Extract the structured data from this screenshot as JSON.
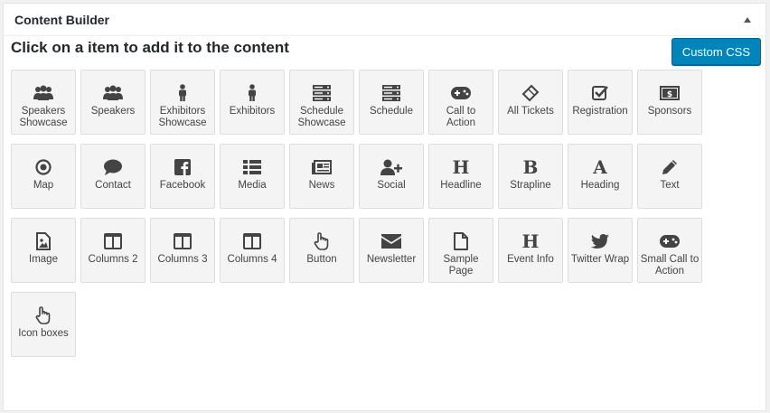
{
  "panel": {
    "title": "Content Builder",
    "subheading": "Click on a item to add it to the content",
    "custom_css_label": "Custom CSS"
  },
  "items": [
    {
      "label": "Speakers Showcase",
      "icon": "group-icon"
    },
    {
      "label": "Speakers",
      "icon": "group-icon"
    },
    {
      "label": "Exhibitors Showcase",
      "icon": "person-icon"
    },
    {
      "label": "Exhibitors",
      "icon": "person-icon"
    },
    {
      "label": "Schedule Showcase",
      "icon": "server-icon"
    },
    {
      "label": "Schedule",
      "icon": "server-icon"
    },
    {
      "label": "Call to Action",
      "icon": "gamepad-icon"
    },
    {
      "label": "All Tickets",
      "icon": "ticket-icon"
    },
    {
      "label": "Registration",
      "icon": "checkbox-icon"
    },
    {
      "label": "Sponsors",
      "icon": "money-icon"
    },
    {
      "label": "Map",
      "icon": "dot-circle-icon"
    },
    {
      "label": "Contact",
      "icon": "comment-icon"
    },
    {
      "label": "Facebook",
      "icon": "facebook-icon"
    },
    {
      "label": "Media",
      "icon": "list-icon"
    },
    {
      "label": "News",
      "icon": "newspaper-icon"
    },
    {
      "label": "Social",
      "icon": "user-plus-icon"
    },
    {
      "label": "Headline",
      "icon": "header-icon"
    },
    {
      "label": "Strapline",
      "icon": "bold-icon"
    },
    {
      "label": "Heading",
      "icon": "font-icon"
    },
    {
      "label": "Text",
      "icon": "pencil-icon"
    },
    {
      "label": "Image",
      "icon": "image-file-icon"
    },
    {
      "label": "Columns 2",
      "icon": "columns-icon"
    },
    {
      "label": "Columns 3",
      "icon": "columns-icon"
    },
    {
      "label": "Columns 4",
      "icon": "columns-icon"
    },
    {
      "label": "Button",
      "icon": "hand-pointer-icon"
    },
    {
      "label": "Newsletter",
      "icon": "envelope-icon"
    },
    {
      "label": "Sample Page",
      "icon": "file-icon"
    },
    {
      "label": "Event Info",
      "icon": "header-icon"
    },
    {
      "label": "Twitter Wrap",
      "icon": "twitter-icon"
    },
    {
      "label": "Small Call to Action",
      "icon": "gamepad-icon"
    },
    {
      "label": "Icon boxes",
      "icon": "hand-pointer-icon"
    }
  ],
  "colors": {
    "accent": "#0085ba",
    "icon": "#444444",
    "tile_bg": "#f4f4f4"
  }
}
